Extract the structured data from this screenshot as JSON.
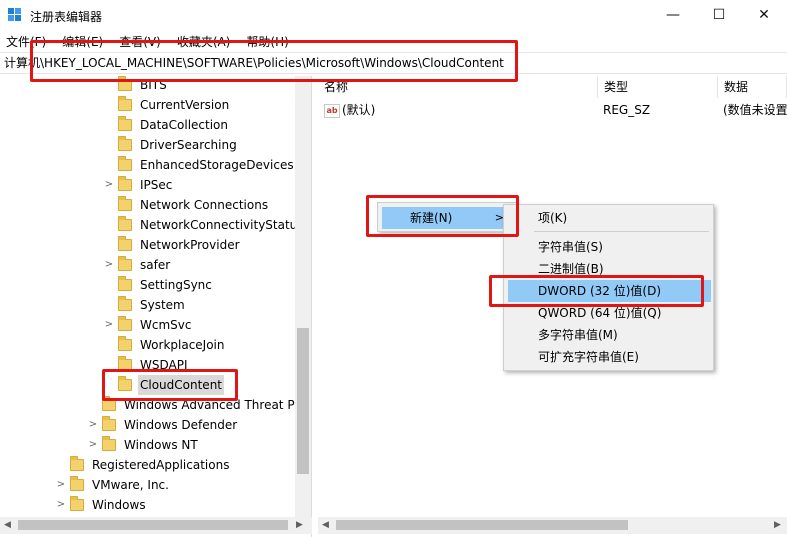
{
  "window": {
    "title": "注册表编辑器",
    "minimize_glyph": "—",
    "maximize_glyph": "☐",
    "close_glyph": "✕"
  },
  "menu": [
    "文件(F)",
    "编辑(E)",
    "查看(V)",
    "收藏夹(A)",
    "帮助(H)"
  ],
  "address": "计算机\\HKEY_LOCAL_MACHINE\\SOFTWARE\\Policies\\Microsoft\\Windows\\CloudContent",
  "tree": [
    {
      "label": "BITS",
      "indent": 3,
      "chevron": ""
    },
    {
      "label": "CurrentVersion",
      "indent": 3,
      "chevron": ""
    },
    {
      "label": "DataCollection",
      "indent": 3,
      "chevron": ""
    },
    {
      "label": "DriverSearching",
      "indent": 3,
      "chevron": ""
    },
    {
      "label": "EnhancedStorageDevices",
      "indent": 3,
      "chevron": ""
    },
    {
      "label": "IPSec",
      "indent": 3,
      "chevron": ">"
    },
    {
      "label": "Network Connections",
      "indent": 3,
      "chevron": ""
    },
    {
      "label": "NetworkConnectivityStatus",
      "indent": 3,
      "chevron": ""
    },
    {
      "label": "NetworkProvider",
      "indent": 3,
      "chevron": ""
    },
    {
      "label": "safer",
      "indent": 3,
      "chevron": ">"
    },
    {
      "label": "SettingSync",
      "indent": 3,
      "chevron": ""
    },
    {
      "label": "System",
      "indent": 3,
      "chevron": ""
    },
    {
      "label": "WcmSvc",
      "indent": 3,
      "chevron": ">"
    },
    {
      "label": "WorkplaceJoin",
      "indent": 3,
      "chevron": ""
    },
    {
      "label": "WSDAPI",
      "indent": 3,
      "chevron": ""
    },
    {
      "label": "CloudContent",
      "indent": 3,
      "chevron": "",
      "selected": true
    },
    {
      "label": "Windows Advanced Threat Pr",
      "indent": 2,
      "chevron": ""
    },
    {
      "label": "Windows Defender",
      "indent": 2,
      "chevron": ">"
    },
    {
      "label": "Windows NT",
      "indent": 2,
      "chevron": ">"
    },
    {
      "label": "RegisteredApplications",
      "indent": 1,
      "chevron": ""
    },
    {
      "label": "VMware, Inc.",
      "indent": 1,
      "chevron": ">"
    },
    {
      "label": "Windows",
      "indent": 1,
      "chevron": ">"
    }
  ],
  "columns": {
    "name": "名称",
    "type": "类型",
    "data": "数据"
  },
  "values": [
    {
      "icon": "ab",
      "name": "(默认)",
      "type": "REG_SZ",
      "data": "(数值未设置"
    }
  ],
  "context_menu": {
    "new_label": "新建(N)",
    "chevron": ">"
  },
  "submenu": [
    {
      "label": "项(K)"
    },
    {
      "separator": true
    },
    {
      "label": "字符串值(S)"
    },
    {
      "label": "二进制值(B)"
    },
    {
      "label": "DWORD (32 位)值(D)",
      "highlight": true
    },
    {
      "label": "QWORD (64 位)值(Q)"
    },
    {
      "label": "多字符串值(M)"
    },
    {
      "label": "可扩充字符串值(E)"
    }
  ],
  "colors": {
    "highlight": "#91c9f7",
    "red_box": "#e01515",
    "folder": "#f3d16b"
  }
}
